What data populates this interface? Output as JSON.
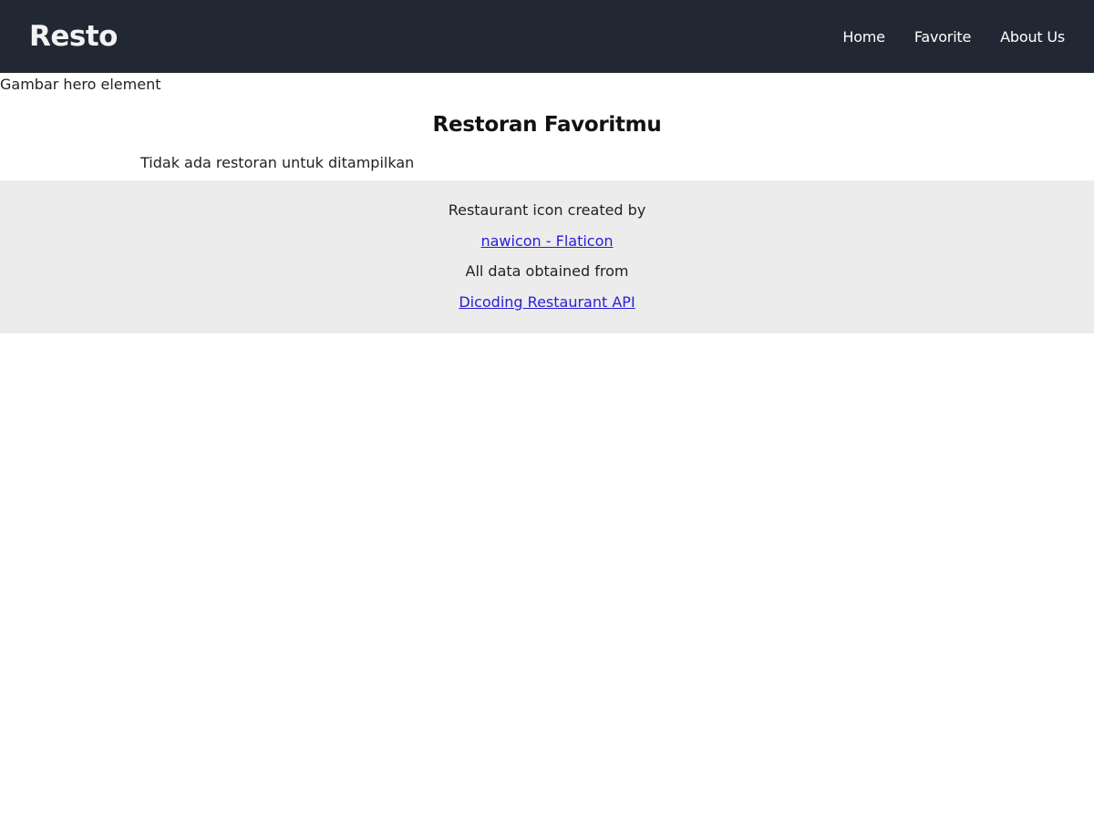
{
  "navbar": {
    "brand": "Resto",
    "links": [
      {
        "label": "Home"
      },
      {
        "label": "Favorite"
      },
      {
        "label": "About Us"
      }
    ],
    "background": "#212833"
  },
  "hero": {
    "alt_text": "Gambar hero element"
  },
  "main": {
    "title": "Restoran Favoritmu",
    "empty_message": "Tidak ada restoran untuk ditampilkan"
  },
  "footer": {
    "icon_credit_text": "Restaurant icon created by",
    "icon_credit_link": "nawicon - Flaticon",
    "data_source_text": "All data obtained from",
    "data_source_link": "Dicoding Restaurant API",
    "background": "#ececec"
  }
}
